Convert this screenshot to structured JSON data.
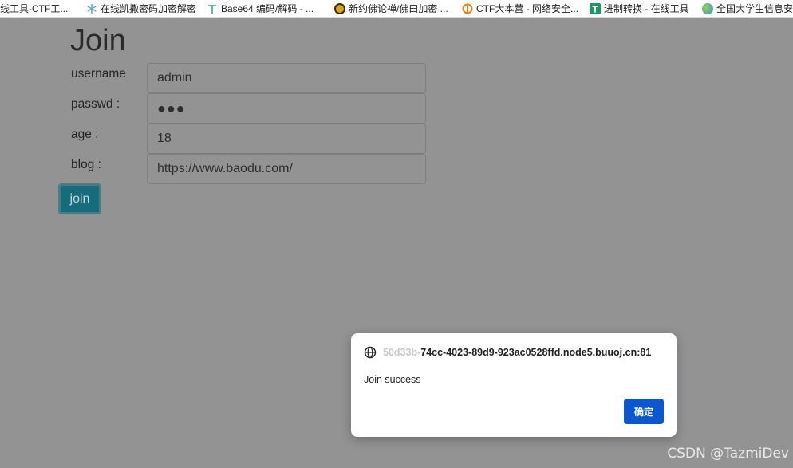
{
  "bookmarks": [
    {
      "label": "线工具-CTF工...",
      "icon": "none"
    },
    {
      "label": "在线凯撒密码加密解密",
      "icon": "snowflake-icon",
      "color": "#5fa8c7"
    },
    {
      "label": "Base64 编码/解码 - ...",
      "icon": "t-logo-icon",
      "color": "#5fbf9a"
    },
    {
      "label": "新约佛论禅/佛曰加密 ...",
      "icon": "buddha-icon",
      "color": "#d9a21b"
    },
    {
      "label": "CTF大本营 - 网络安全...",
      "icon": "flag-icon",
      "color": "#f07a1a"
    },
    {
      "label": "进制转换 - 在线工具",
      "icon": "t-square-icon",
      "color": "#1a9960"
    },
    {
      "label": "全国大学生信息安",
      "icon": "globe-colored-icon",
      "color": "#3c8fd8"
    }
  ],
  "form": {
    "title": "Join",
    "fields": [
      {
        "label": "username",
        "value": "admin"
      },
      {
        "label": "passwd :",
        "value": "●●●"
      },
      {
        "label": "age :",
        "value": "18"
      },
      {
        "label": "blog :",
        "value": "https://www.baodu.com/"
      }
    ],
    "submit_label": "join"
  },
  "dialog": {
    "host_faded": "50d33b-",
    "host": "74cc-4023-89d9-923ac0528ffd.node5.buuoj.cn:81",
    "message": "Join success",
    "ok_label": "确定"
  },
  "watermark": "CSDN @TazmiDev"
}
